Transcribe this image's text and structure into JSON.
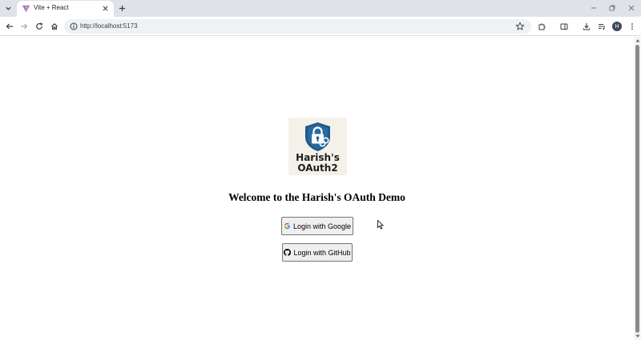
{
  "browser": {
    "tab": {
      "title": "Vite + React",
      "favicon": "vite-icon"
    },
    "address_bar": {
      "url": "http://localhost:5173"
    },
    "profile_initial": "H",
    "icons": [
      "tab-list-icon",
      "close-icon",
      "new-tab-icon",
      "minimize-icon",
      "restore-icon",
      "window-close-icon",
      "back-icon",
      "forward-icon",
      "reload-icon",
      "home-icon",
      "site-info-icon",
      "bookmark-star-icon",
      "extensions-icon",
      "side-panel-icon",
      "downloads-icon",
      "media-controls-icon",
      "menu-icon"
    ]
  },
  "page": {
    "logo": {
      "line1": "Harish's",
      "line2": "OAuth2",
      "badge_color": "#1f5a8a",
      "background": "#f4f1e9"
    },
    "heading": "Welcome to the Harish's OAuth Demo",
    "buttons": {
      "google": {
        "label": "Login with Google",
        "icon": "google-icon"
      },
      "github": {
        "label": "Login with GitHub",
        "icon": "github-icon"
      }
    }
  }
}
